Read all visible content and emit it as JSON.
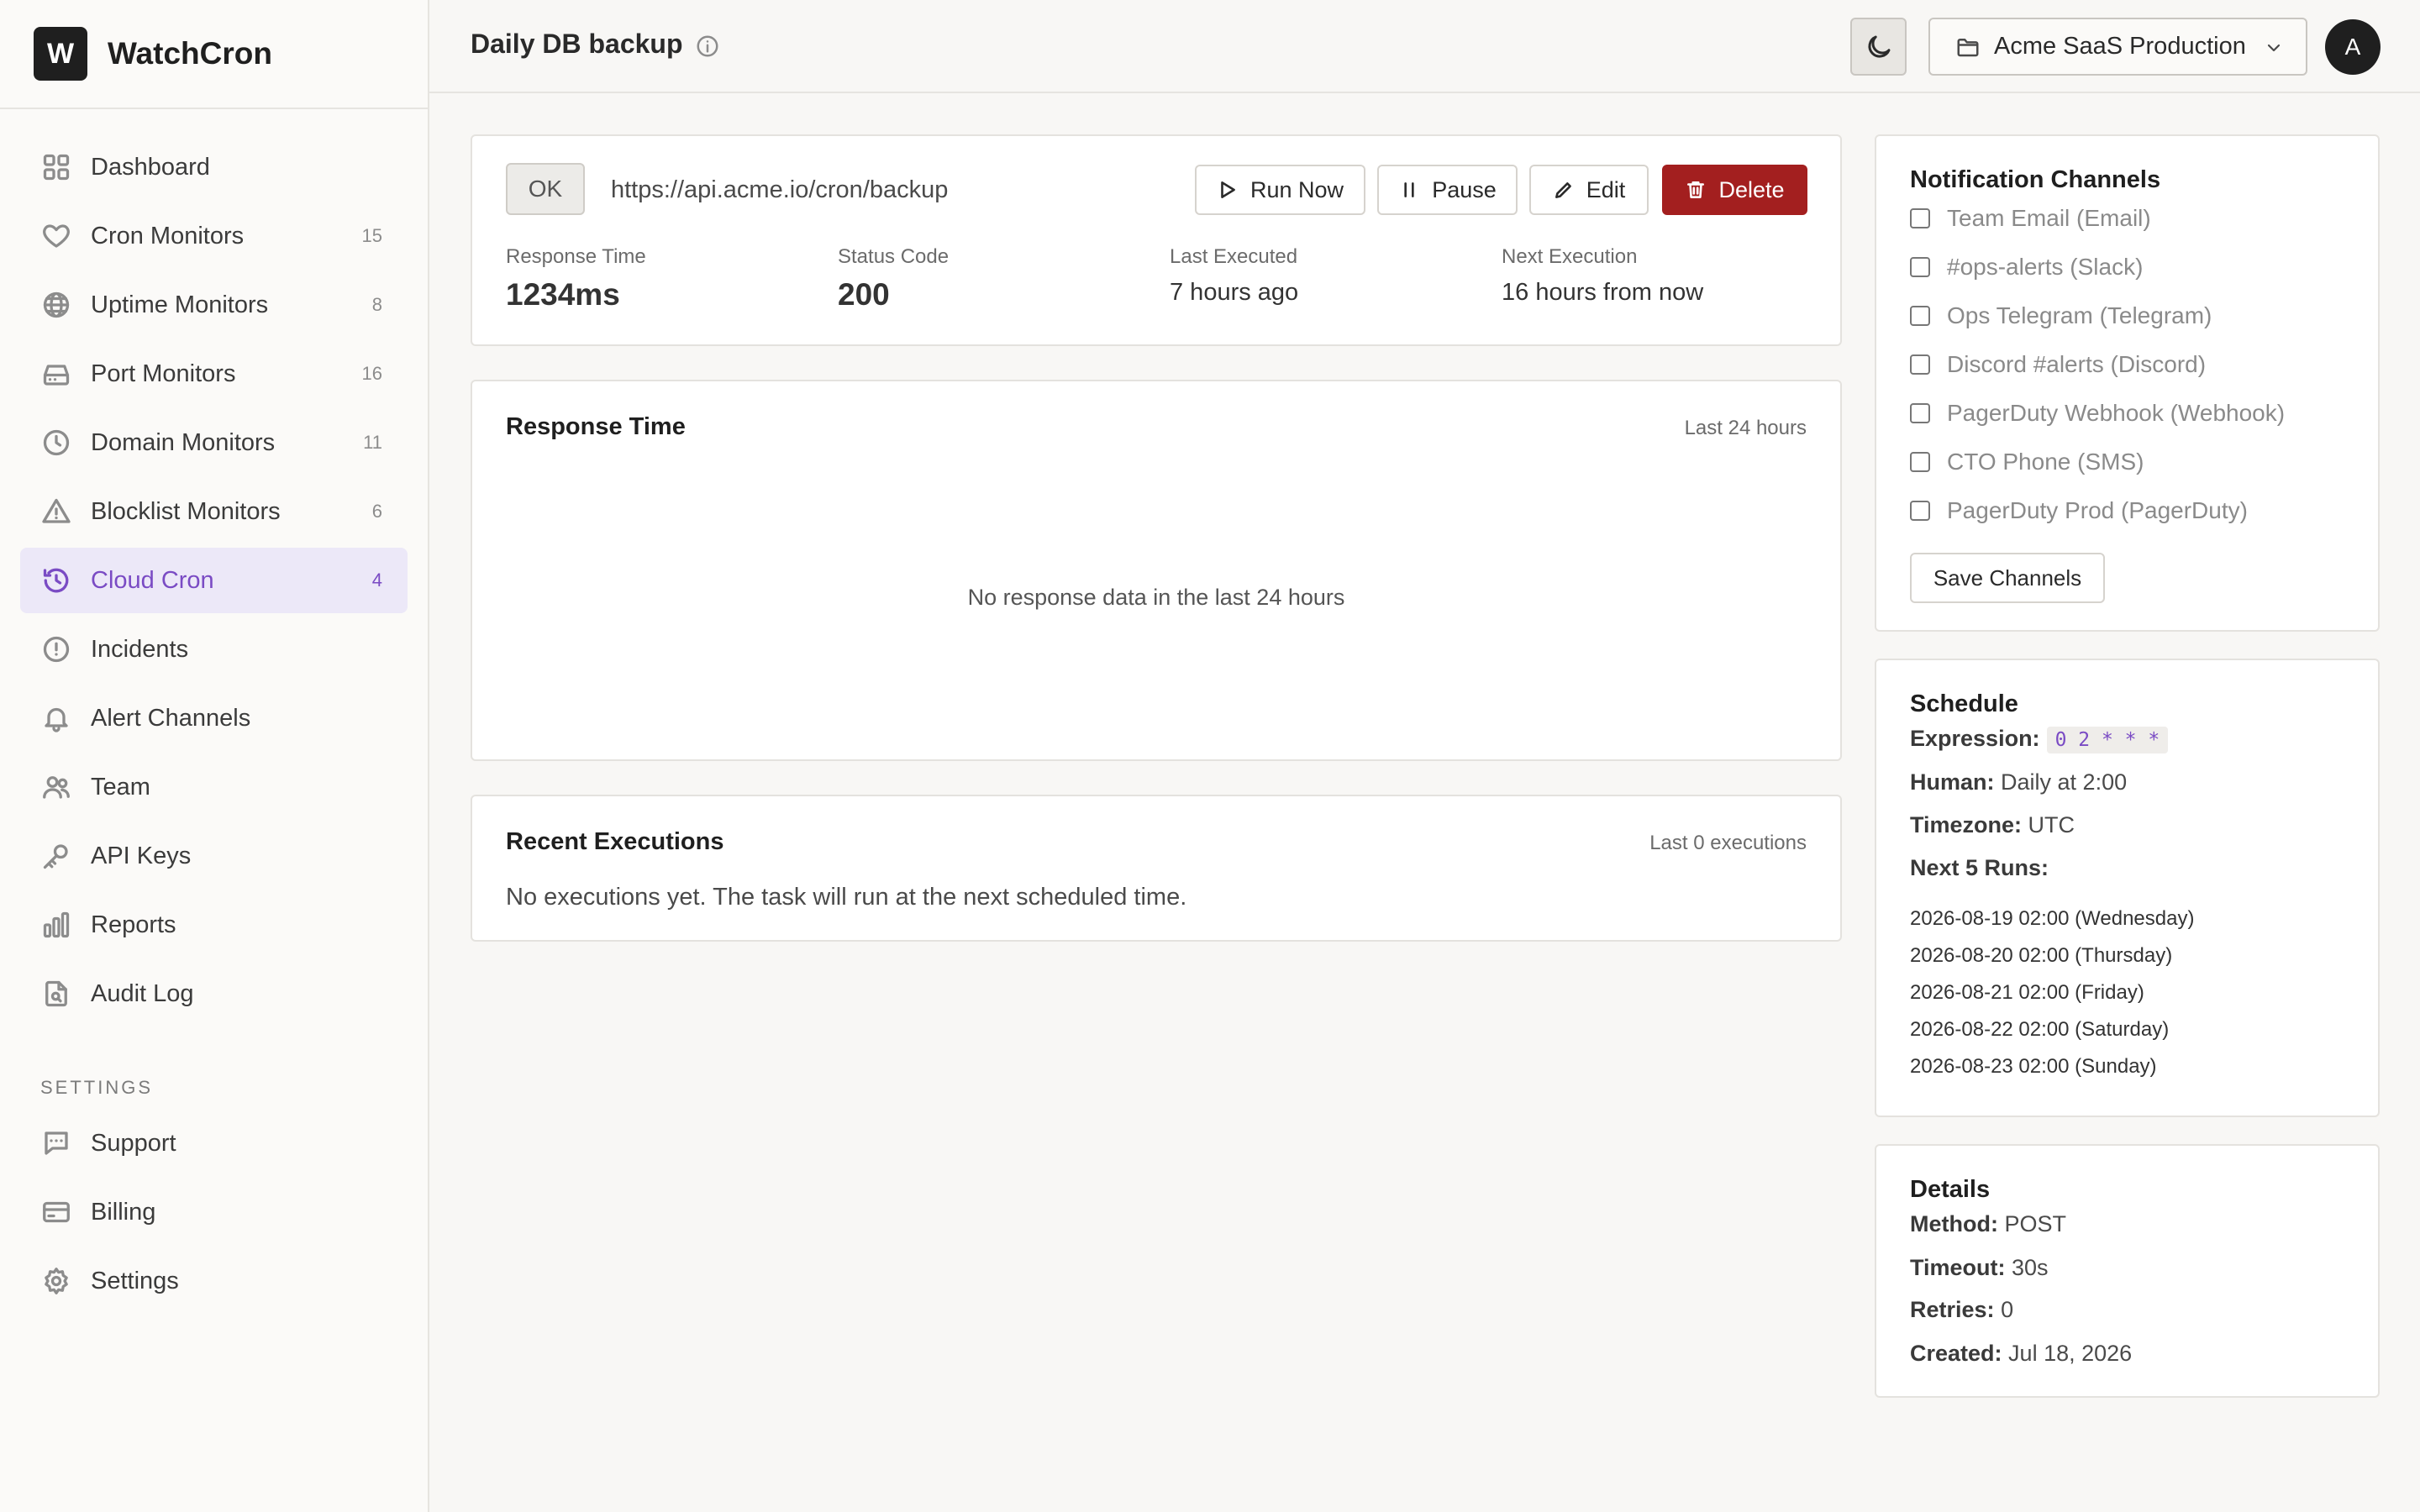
{
  "app": {
    "logo_letter": "W",
    "name": "WatchCron"
  },
  "sidebar": {
    "items": [
      {
        "label": "Dashboard",
        "count": "",
        "icon": "grid-icon"
      },
      {
        "label": "Cron Monitors",
        "count": "15",
        "icon": "heart-icon"
      },
      {
        "label": "Uptime Monitors",
        "count": "8",
        "icon": "globe-icon"
      },
      {
        "label": "Port Monitors",
        "count": "16",
        "icon": "server-icon"
      },
      {
        "label": "Domain Monitors",
        "count": "11",
        "icon": "clock-icon"
      },
      {
        "label": "Blocklist Monitors",
        "count": "6",
        "icon": "warning-icon"
      },
      {
        "label": "Cloud Cron",
        "count": "4",
        "icon": "clock-history-icon",
        "active": true
      },
      {
        "label": "Incidents",
        "count": "",
        "icon": "alert-circle-icon"
      },
      {
        "label": "Alert Channels",
        "count": "",
        "icon": "bell-icon"
      },
      {
        "label": "Team",
        "count": "",
        "icon": "users-icon"
      },
      {
        "label": "API Keys",
        "count": "",
        "icon": "key-icon"
      },
      {
        "label": "Reports",
        "count": "",
        "icon": "bar-chart-icon"
      },
      {
        "label": "Audit Log",
        "count": "",
        "icon": "file-search-icon"
      }
    ],
    "settings_heading": "SETTINGS",
    "settings_items": [
      {
        "label": "Support",
        "icon": "message-icon"
      },
      {
        "label": "Billing",
        "icon": "credit-card-icon"
      },
      {
        "label": "Settings",
        "icon": "gear-icon"
      }
    ]
  },
  "header": {
    "title": "Daily DB backup",
    "org": "Acme SaaS Production",
    "avatar_letter": "A"
  },
  "summary": {
    "status": "OK",
    "url": "https://api.acme.io/cron/backup",
    "buttons": {
      "run": "Run Now",
      "pause": "Pause",
      "edit": "Edit",
      "delete": "Delete"
    },
    "stats": [
      {
        "label": "Response Time",
        "value": "1234ms"
      },
      {
        "label": "Status Code",
        "value": "200"
      },
      {
        "label": "Last Executed",
        "value": "7 hours ago"
      },
      {
        "label": "Next Execution",
        "value": "16 hours from now"
      }
    ]
  },
  "response_chart": {
    "title": "Response Time",
    "range": "Last 24 hours",
    "empty": "No response data in the last 24 hours"
  },
  "executions": {
    "title": "Recent Executions",
    "meta": "Last 0 executions",
    "empty": "No executions yet. The task will run at the next scheduled time."
  },
  "notifications": {
    "title": "Notification Channels",
    "channels": [
      "Team Email (Email)",
      "#ops-alerts (Slack)",
      "Ops Telegram (Telegram)",
      "Discord #alerts (Discord)",
      "PagerDuty Webhook (Webhook)",
      "CTO Phone (SMS)",
      "PagerDuty Prod (PagerDuty)"
    ],
    "save_label": "Save Channels"
  },
  "schedule": {
    "title": "Schedule",
    "expression_label": "Expression:",
    "expression": "0 2 * * *",
    "human_label": "Human:",
    "human": "Daily at 2:00",
    "timezone_label": "Timezone:",
    "timezone": "UTC",
    "next_runs_label": "Next 5 Runs:",
    "next_runs": [
      "2026-08-19 02:00 (Wednesday)",
      "2026-08-20 02:00 (Thursday)",
      "2026-08-21 02:00 (Friday)",
      "2026-08-22 02:00 (Saturday)",
      "2026-08-23 02:00 (Sunday)"
    ]
  },
  "details": {
    "title": "Details",
    "method_label": "Method:",
    "method": "POST",
    "timeout_label": "Timeout:",
    "timeout": "30s",
    "retries_label": "Retries:",
    "retries": "0",
    "created_label": "Created:",
    "created": "Jul 18, 2026"
  },
  "colors": {
    "accent": "#7a4bc4",
    "danger": "#a31f1f",
    "active_bg": "#ece8f8"
  }
}
